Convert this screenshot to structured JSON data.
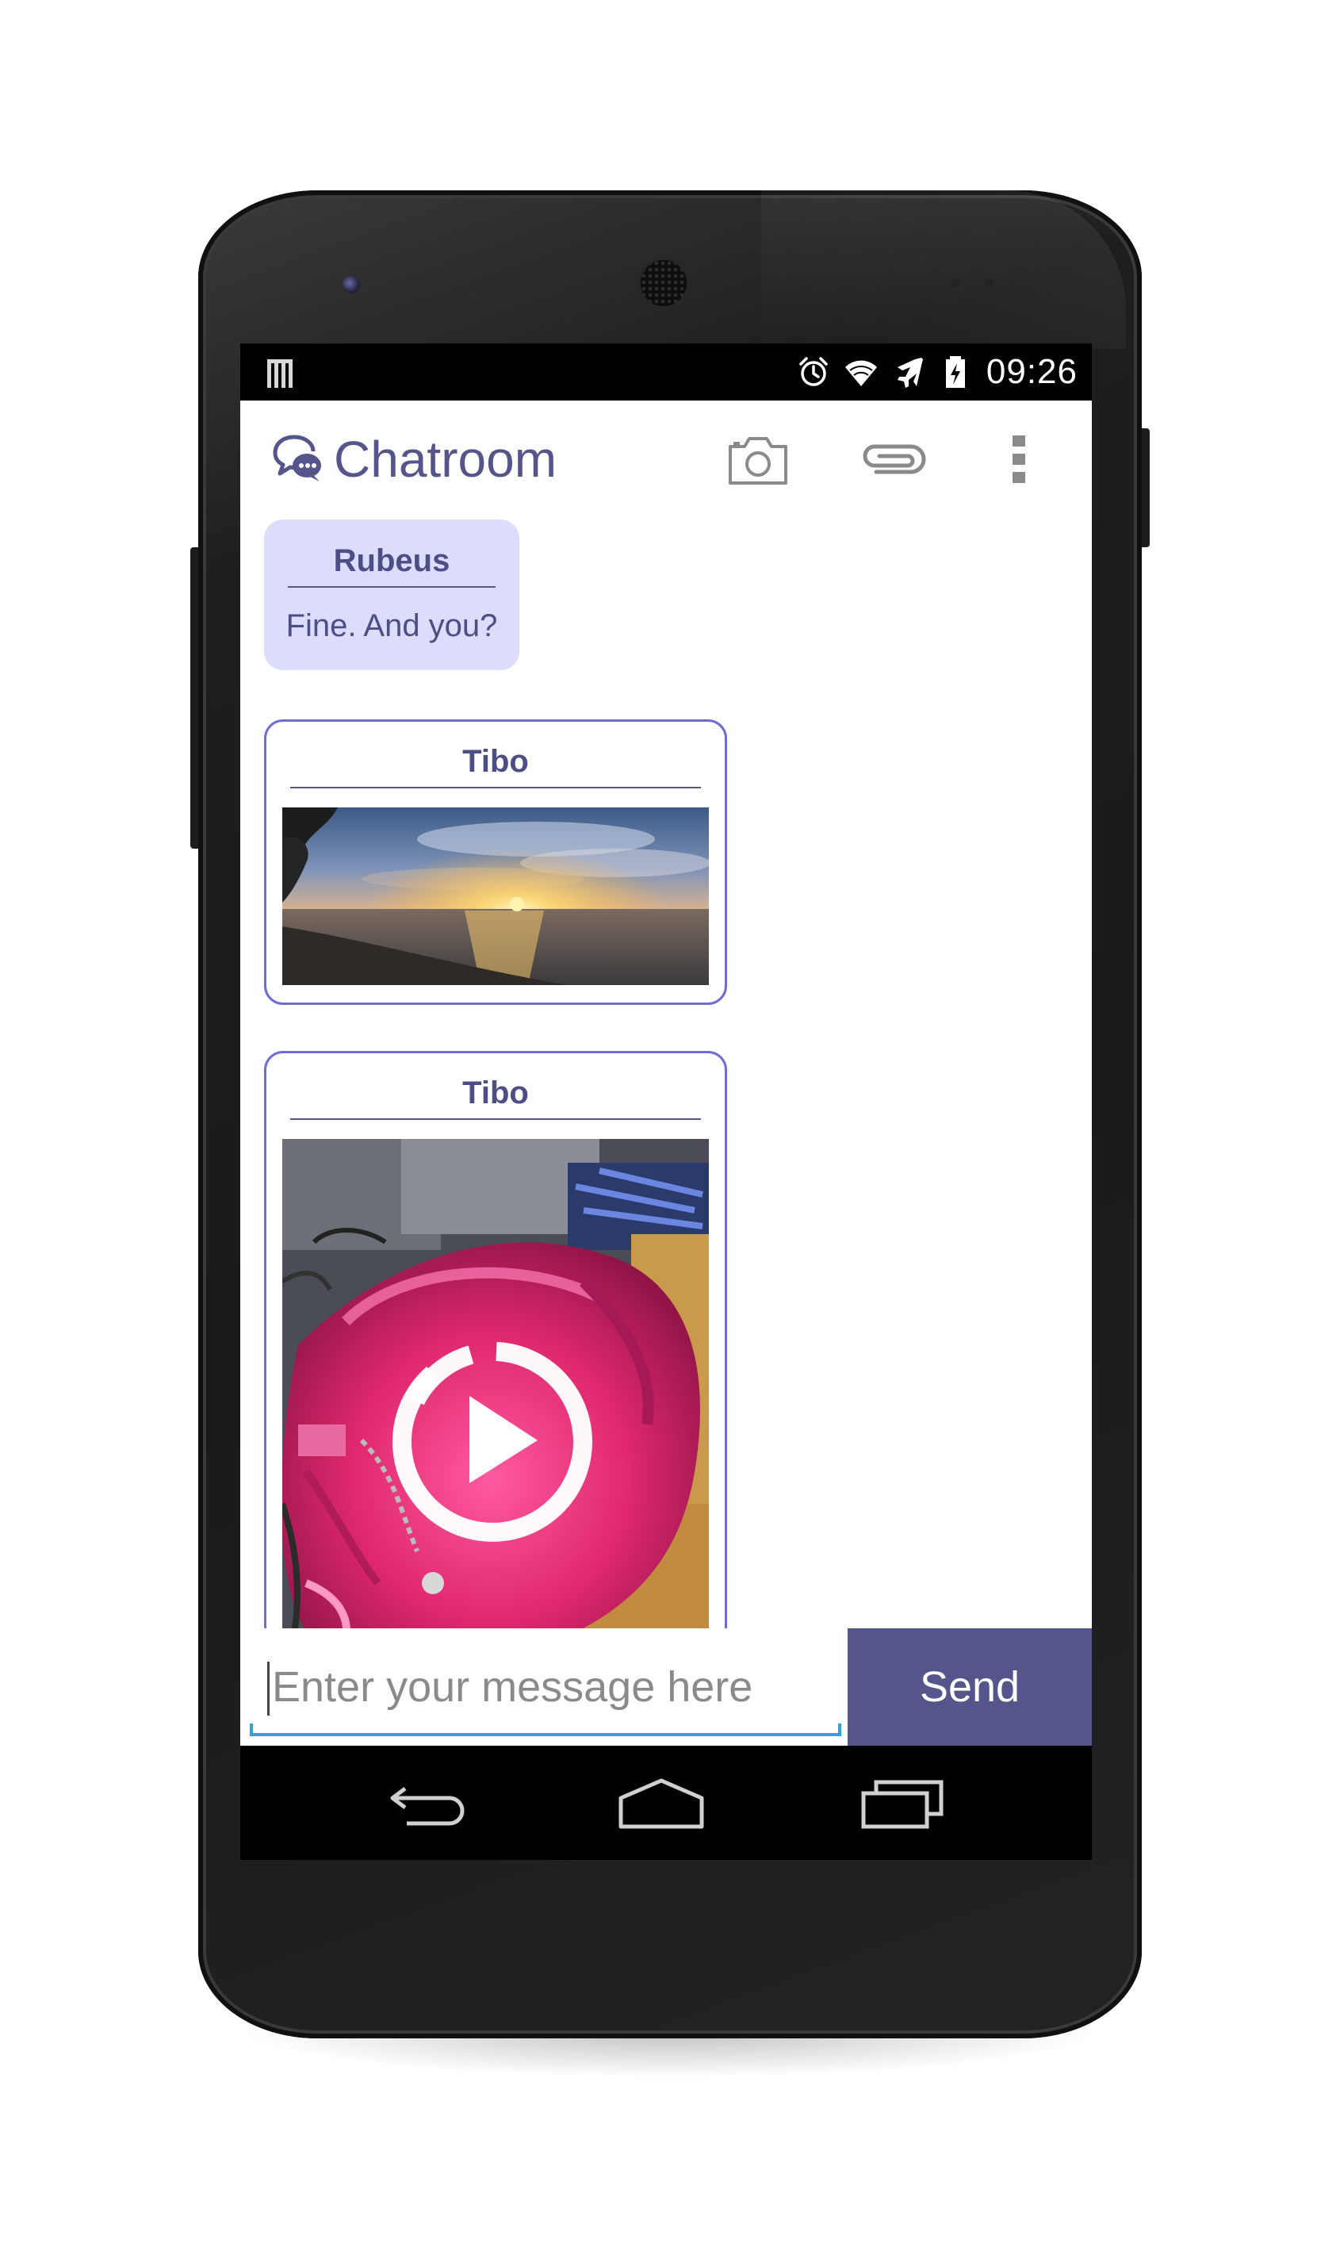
{
  "status_bar": {
    "time": "09:26",
    "left_icon": "notification-bars-icon",
    "icons": [
      "alarm-icon",
      "wifi-icon",
      "airplane-mode-icon",
      "battery-charging-icon"
    ]
  },
  "action_bar": {
    "app_icon": "chat-bubbles-icon",
    "title": "Chatroom",
    "actions": [
      "camera-icon",
      "paperclip-icon",
      "overflow-menu-icon"
    ]
  },
  "messages": [
    {
      "type": "text",
      "sender": "Rubeus",
      "text": "Fine. And you?"
    },
    {
      "type": "image",
      "sender": "Tibo",
      "content": "sunset-beach-photo"
    },
    {
      "type": "video",
      "sender": "Tibo",
      "content": "pink-handbag-video-thumbnail",
      "overlay_icon": "play-icon"
    }
  ],
  "composer": {
    "placeholder": "Enter your message here",
    "value": "",
    "send_label": "Send"
  },
  "nav_bar": {
    "buttons": [
      "back-icon",
      "home-icon",
      "recents-icon"
    ]
  },
  "colors": {
    "accent": "#55558c",
    "bubble_fill": "#dcdcfc",
    "bubble_border": "#6c6cd2",
    "input_underline": "#2fa3d6",
    "status_bar": "#000000"
  }
}
